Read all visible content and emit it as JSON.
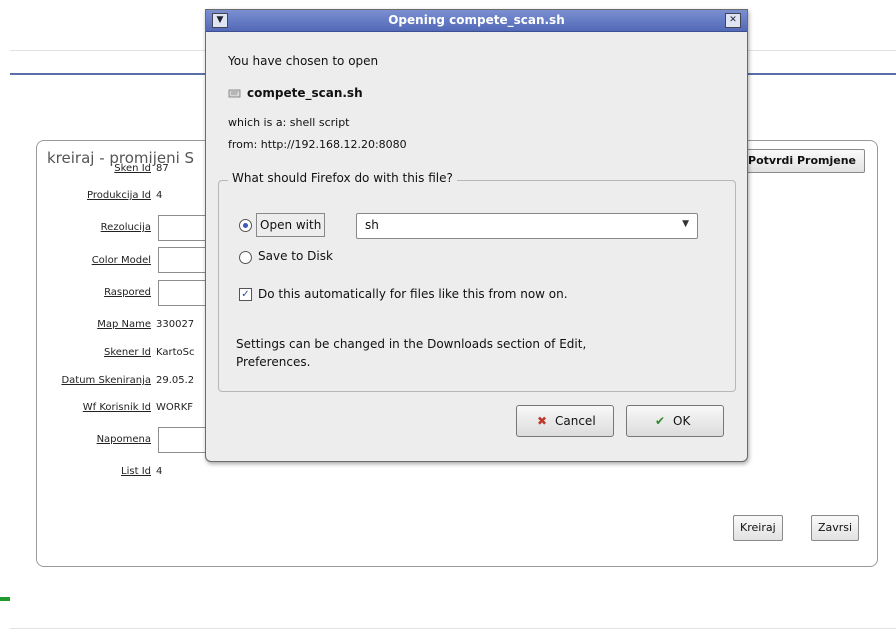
{
  "dialog": {
    "title": "Opening compete_scan.sh",
    "intro": "You have chosen to open",
    "filename": "compete_scan.sh",
    "which_is": "which is a:  shell script",
    "from": "from:  http://192.168.12.20:8080",
    "question": "What should Firefox do with this file?",
    "open_with_label": "Open with",
    "open_with_app": "sh",
    "save_to_disk": "Save to Disk",
    "auto_label": "Do this automatically for files like this from now on.",
    "settings_line1": "Settings can be changed in the Downloads section of Edit,",
    "settings_line2": "Preferences.",
    "cancel": "Cancel",
    "ok": "OK"
  },
  "form": {
    "title": "kreiraj - promijeni S",
    "confirm": "Potvrdi Promjene",
    "fields": [
      {
        "label": "Sken Id",
        "value": "87"
      },
      {
        "label": "Produkcija Id",
        "value": "4"
      },
      {
        "label": "Rezolucija",
        "value": ""
      },
      {
        "label": "Color Model",
        "value": ""
      },
      {
        "label": "Raspored",
        "value": ""
      },
      {
        "label": "Map Name",
        "value": "330027"
      },
      {
        "label": "Skener Id",
        "value": "KartoSc"
      },
      {
        "label": "Datum Skeniranja",
        "value": "29.05.2"
      },
      {
        "label": "Wf Korisnik Id",
        "value": "WORKF"
      },
      {
        "label": "Napomena",
        "value": ""
      },
      {
        "label": "List Id",
        "value": "4"
      }
    ],
    "kreiraj": "Kreiraj",
    "zavrsi": "Zavrsi"
  }
}
